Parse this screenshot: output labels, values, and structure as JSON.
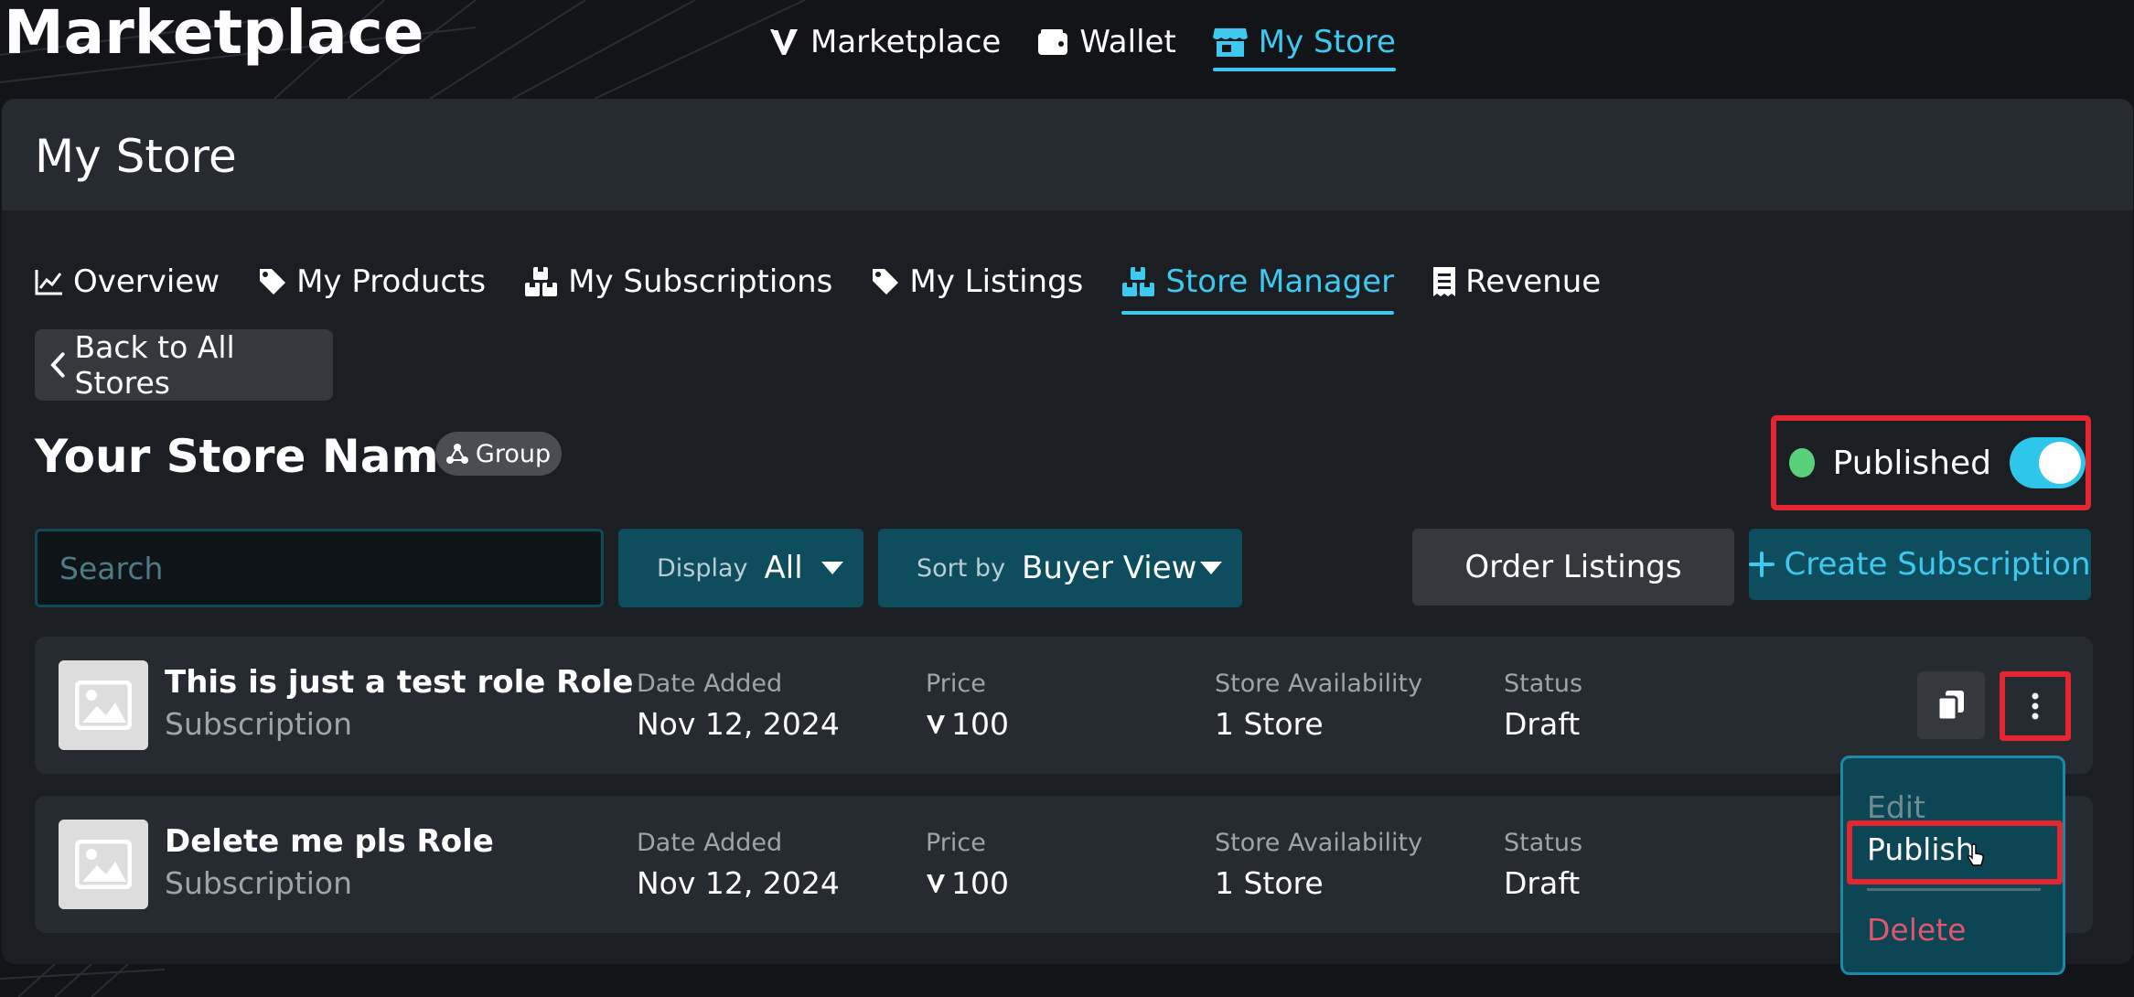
{
  "app": {
    "title": "Marketplace"
  },
  "top_nav": [
    {
      "label": "Marketplace",
      "icon": "v-logo-icon",
      "active": false
    },
    {
      "label": "Wallet",
      "icon": "wallet-icon",
      "active": false
    },
    {
      "label": "My Store",
      "icon": "store-icon",
      "active": true
    }
  ],
  "page": {
    "title": "My Store"
  },
  "tabs": [
    {
      "label": "Overview",
      "icon": "chart-line-icon"
    },
    {
      "label": "My Products",
      "icon": "tag-icon"
    },
    {
      "label": "My Subscriptions",
      "icon": "boxes-icon"
    },
    {
      "label": "My Listings",
      "icon": "tag-icon"
    },
    {
      "label": "Store Manager",
      "icon": "boxes-icon",
      "active": true
    },
    {
      "label": "Revenue",
      "icon": "receipt-icon"
    }
  ],
  "back_button": {
    "label": "Back to All Stores"
  },
  "store": {
    "name": "Your Store Name",
    "badge": "Group",
    "status_label": "Published",
    "status_color": "#5ad07a",
    "published": true
  },
  "filters": {
    "search_placeholder": "Search",
    "display_label": "Display",
    "display_value": "All",
    "sort_label": "Sort by",
    "sort_value": "Buyer View"
  },
  "actions": {
    "order_listings": "Order Listings",
    "create_subscription": "Create Subscription"
  },
  "columns": {
    "date_added": "Date Added",
    "price": "Price",
    "availability": "Store Availability",
    "status": "Status"
  },
  "rows": [
    {
      "name": "This is just a test role Role",
      "type": "Subscription",
      "date_added": "Nov 12, 2024",
      "price": "100",
      "availability": "1 Store",
      "status": "Draft"
    },
    {
      "name": "Delete me pls Role",
      "type": "Subscription",
      "date_added": "Nov 12, 2024",
      "price": "100",
      "availability": "1 Store",
      "status": "Draft"
    }
  ],
  "menu": {
    "edit": "Edit",
    "publish": "Publish",
    "delete": "Delete"
  },
  "colors": {
    "accent": "#3dc9f0",
    "panel": "#1b1e23",
    "highlight": "#e3262f",
    "danger": "#e0566b"
  }
}
